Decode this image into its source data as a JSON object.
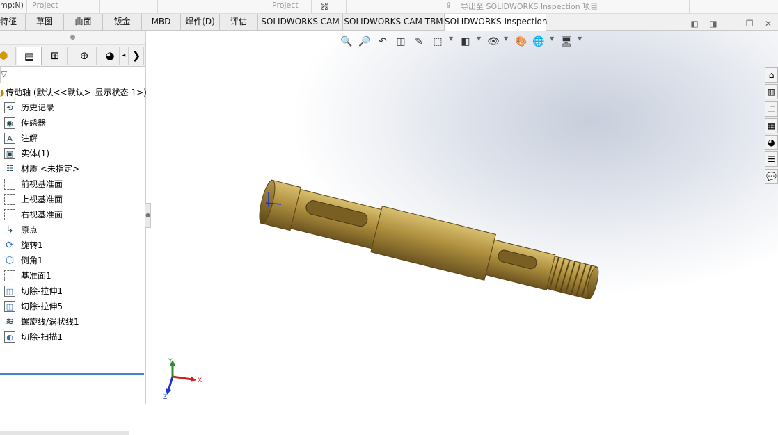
{
  "top_strip": {
    "left_text": "mp;N)",
    "project_1": "Project",
    "project_2": "Project",
    "device_icon": "器",
    "export_label": "导出至 SOLIDWORKS Inspection 项目"
  },
  "command_tabs": [
    {
      "label": "特征"
    },
    {
      "label": "草图"
    },
    {
      "label": "曲面"
    },
    {
      "label": "钣金"
    },
    {
      "label": "MBD"
    },
    {
      "label": "焊件(D)"
    },
    {
      "label": "评估"
    },
    {
      "label": "SOLIDWORKS CAM"
    },
    {
      "label": "SOLIDWORKS CAM TBM"
    },
    {
      "label": "SOLIDWORKS Inspection",
      "active": true
    }
  ],
  "feature_tree": {
    "root": "传动轴 (默认<<默认>_显示状态 1>)",
    "items": [
      {
        "label": "历史记录",
        "icon": "history-icon"
      },
      {
        "label": "传感器",
        "icon": "sensor-icon"
      },
      {
        "label": "注解",
        "icon": "annotation-icon"
      },
      {
        "label": "实体(1)",
        "icon": "solid-body-icon"
      },
      {
        "label": "材质 <未指定>",
        "icon": "material-icon"
      },
      {
        "label": "前视基准面",
        "icon": "plane-icon"
      },
      {
        "label": "上视基准面",
        "icon": "plane-icon"
      },
      {
        "label": "右视基准面",
        "icon": "plane-icon"
      },
      {
        "label": "原点",
        "icon": "origin-icon"
      },
      {
        "label": "旋转1",
        "icon": "revolve-icon"
      },
      {
        "label": "倒角1",
        "icon": "chamfer-icon"
      },
      {
        "label": "基准面1",
        "icon": "plane-icon"
      },
      {
        "label": "切除-拉伸1",
        "icon": "cut-extrude-icon"
      },
      {
        "label": "切除-拉伸5",
        "icon": "cut-extrude-icon"
      },
      {
        "label": "螺旋线/涡状线1",
        "icon": "helix-icon"
      },
      {
        "label": "切除-扫描1",
        "icon": "cut-sweep-icon"
      }
    ]
  },
  "triad": {
    "x_label": "X",
    "y_label": "Y",
    "z_label": "Z"
  },
  "colors": {
    "part_body": "#a88a3c",
    "rollback_bar": "#3f85c9",
    "active_tab": "#ffffff"
  }
}
